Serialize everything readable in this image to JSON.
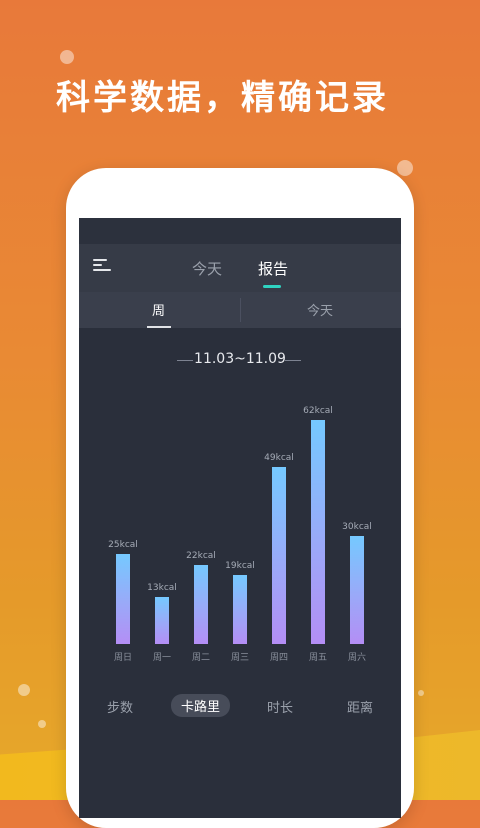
{
  "headline": "科学数据，精确记录",
  "nav": {
    "tab_today": "今天",
    "tab_report": "报告"
  },
  "subtabs": {
    "week": "周",
    "today": "今天"
  },
  "date_range": "11.03~11.09",
  "chart_data": {
    "type": "bar",
    "categories": [
      "周日",
      "周一",
      "周二",
      "周三",
      "周四",
      "周五",
      "周六"
    ],
    "values": [
      25,
      13,
      22,
      19,
      49,
      62,
      30
    ],
    "data_labels": [
      "25kcal",
      "13kcal",
      "22kcal",
      "19kcal",
      "49kcal",
      "62kcal",
      "30kcal"
    ],
    "title": "",
    "xlabel": "",
    "ylabel": "",
    "ylim": [
      0,
      62
    ],
    "grid": false,
    "bar_gradient": [
      "#75c9ff",
      "#b48ef5"
    ]
  },
  "metrics": [
    {
      "label": "步数",
      "active": false
    },
    {
      "label": "卡路里",
      "active": true
    },
    {
      "label": "时长",
      "active": false
    },
    {
      "label": "距离",
      "active": false
    }
  ],
  "colors": {
    "accent": "#2fd3c1",
    "screen_bg": "#2a2f3b",
    "orange_bg": "#e8793a"
  }
}
